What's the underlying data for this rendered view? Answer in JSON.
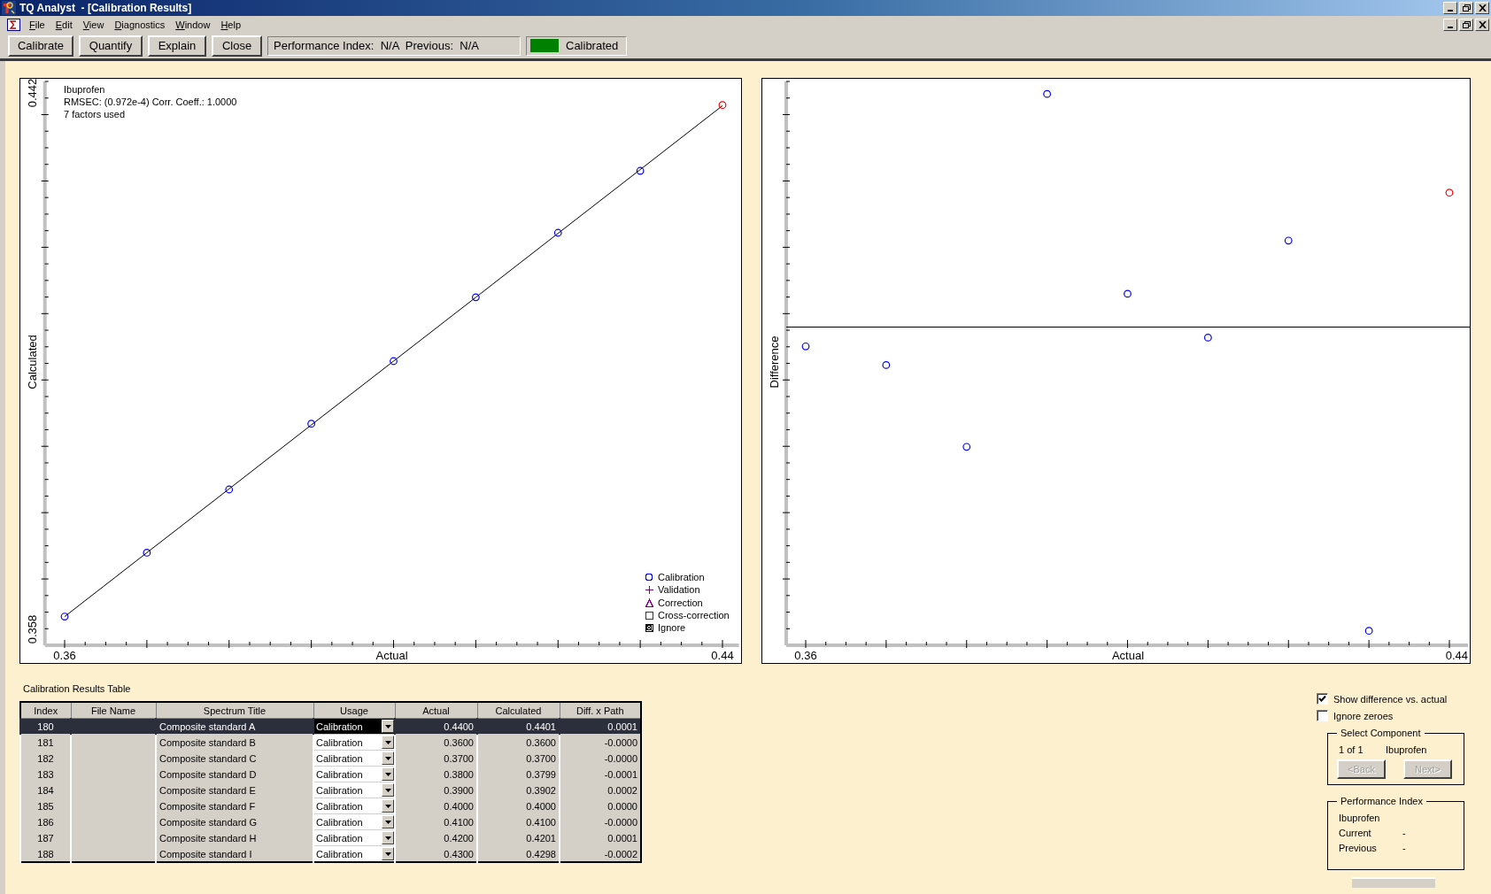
{
  "window": {
    "title": "TQ Analyst  - [Calibration Results]"
  },
  "menu": [
    "File",
    "Edit",
    "View",
    "Diagnostics",
    "Window",
    "Help"
  ],
  "toolbar": {
    "buttons": [
      "Calibrate",
      "Quantify",
      "Explain",
      "Close"
    ],
    "performance": "Performance Index:  N/A  Previous:  N/A",
    "status": {
      "label": "Calibrated",
      "calibrated": true
    }
  },
  "calibration_plot": {
    "info": [
      "Ibuprofen",
      "RMSEC: (0.972e-4)   Corr. Coeff.: 1.0000",
      "7 factors used"
    ],
    "legend": [
      {
        "label": "Calibration",
        "kind": "circle",
        "color": "#0000ff"
      },
      {
        "label": "Validation",
        "kind": "plus",
        "color": "#800080"
      },
      {
        "label": "Correction",
        "kind": "triangle",
        "color": "#800080"
      },
      {
        "label": "Cross-correction",
        "kind": "square",
        "color": "#800080"
      },
      {
        "label": "Ignore",
        "kind": "ignore",
        "color": "#000000"
      }
    ],
    "chart_data": {
      "type": "scatter",
      "xlabel": "Actual",
      "ylabel": "Calculated",
      "x": [
        0.36,
        0.37,
        0.38,
        0.39,
        0.4,
        0.41,
        0.42,
        0.43,
        0.44
      ],
      "series": [
        {
          "color": "#0000ff",
          "values": [
            0.36,
            0.37,
            0.3799,
            0.3902,
            0.4,
            0.41,
            0.4201,
            0.4298,
            null
          ]
        },
        {
          "color": "#ff0000",
          "values": [
            null,
            null,
            null,
            null,
            null,
            null,
            null,
            null,
            0.4401
          ]
        },
        {
          "type": "line",
          "color": "#000000",
          "values": [
            0.36,
            0.37,
            0.38,
            0.39,
            0.4,
            0.41,
            0.42,
            0.43,
            0.44
          ]
        }
      ],
      "xlim": [
        0.3576,
        0.442
      ],
      "ylim": [
        0.3555,
        0.4438
      ],
      "xticks": [
        {
          "value": 0.36,
          "label": "0.36"
        },
        {
          "value": 0.44,
          "label": "0.44"
        }
      ],
      "yticks": [
        {
          "value": 0.358,
          "label": "0.358"
        },
        {
          "value": 0.442,
          "label": "0.442"
        }
      ]
    }
  },
  "difference_plot": {
    "xlabel": "Actual",
    "ylabel": "Difference",
    "xtick_labels": [
      "0.36",
      "0.44"
    ]
  },
  "table": {
    "title": "Calibration Results Table",
    "columns": [
      "Index",
      "File Name",
      "Spectrum Title",
      "Usage",
      "Actual",
      "Calculated",
      "Diff. x Path"
    ],
    "rows": [
      {
        "index": "180",
        "title": "Composite standard A",
        "usage": "Calibration",
        "actual": "0.4400",
        "calculated": "0.4401",
        "diff": "0.0001",
        "selected": true
      },
      {
        "index": "181",
        "title": "Composite standard B",
        "usage": "Calibration",
        "actual": "0.3600",
        "calculated": "0.3600",
        "diff": "-0.0000",
        "selected": false
      },
      {
        "index": "182",
        "title": "Composite standard C",
        "usage": "Calibration",
        "actual": "0.3700",
        "calculated": "0.3700",
        "diff": "-0.0000",
        "selected": false
      },
      {
        "index": "183",
        "title": "Composite standard D",
        "usage": "Calibration",
        "actual": "0.3800",
        "calculated": "0.3799",
        "diff": "-0.0001",
        "selected": false
      },
      {
        "index": "184",
        "title": "Composite standard E",
        "usage": "Calibration",
        "actual": "0.3900",
        "calculated": "0.3902",
        "diff": "0.0002",
        "selected": false
      },
      {
        "index": "185",
        "title": "Composite standard F",
        "usage": "Calibration",
        "actual": "0.4000",
        "calculated": "0.4000",
        "diff": "0.0000",
        "selected": false
      },
      {
        "index": "186",
        "title": "Composite standard G",
        "usage": "Calibration",
        "actual": "0.4100",
        "calculated": "0.4100",
        "diff": "-0.0000",
        "selected": false
      },
      {
        "index": "187",
        "title": "Composite standard H",
        "usage": "Calibration",
        "actual": "0.4200",
        "calculated": "0.4201",
        "diff": "0.0001",
        "selected": false
      },
      {
        "index": "188",
        "title": "Composite standard I",
        "usage": "Calibration",
        "actual": "0.4300",
        "calculated": "0.4298",
        "diff": "-0.0002",
        "selected": false
      }
    ]
  },
  "options": [
    {
      "label": "Show difference vs. actual",
      "checked": true
    },
    {
      "label": "Ignore zeroes",
      "checked": false
    }
  ],
  "select_component": {
    "title": "Select Component",
    "position": "1 of 1",
    "component": "Ibuprofen",
    "buttons": [
      {
        "label": "<Back",
        "disabled": true
      },
      {
        "label": "Next>",
        "disabled": true
      }
    ]
  },
  "performance_index": {
    "title": "Performance Index",
    "component": "Ibuprofen",
    "rows": [
      {
        "label": "Current",
        "value": "-"
      },
      {
        "label": "Previous",
        "value": "-"
      }
    ]
  }
}
